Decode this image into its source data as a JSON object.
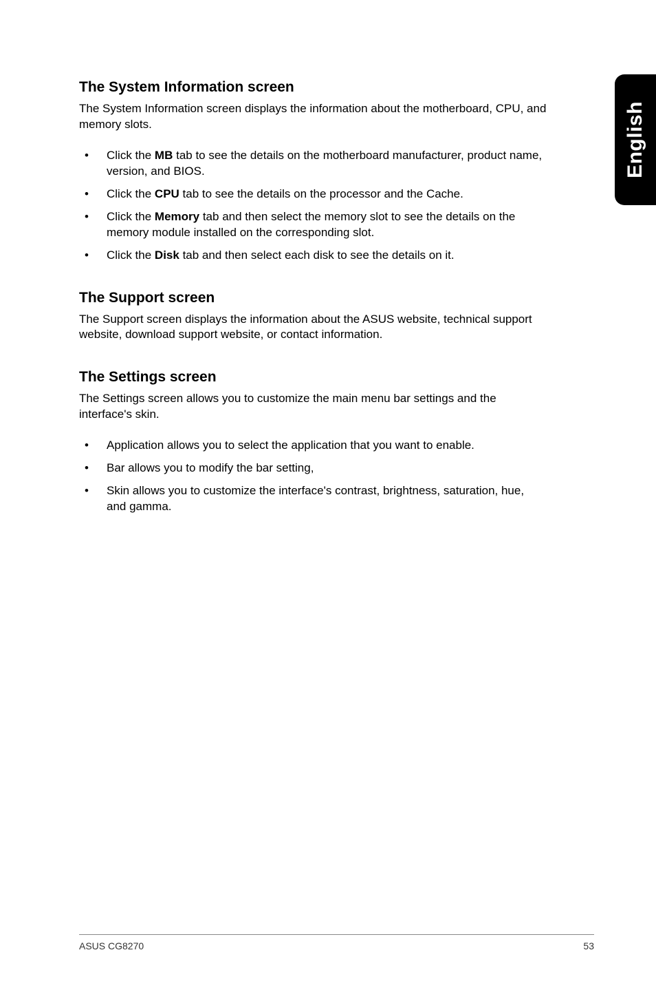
{
  "side_tab": "English",
  "sections": {
    "sysinfo": {
      "title": "The System Information screen",
      "intro": "The System Information screen displays the information about the motherboard, CPU, and memory slots.",
      "bullets": [
        {
          "pre": "Click the ",
          "bold": "MB",
          "post": " tab to see the details on the motherboard manufacturer, product name, version, and BIOS."
        },
        {
          "pre": "Click the ",
          "bold": "CPU",
          "post": " tab to see the details on the processor and the Cache."
        },
        {
          "pre": "Click the ",
          "bold": "Memory",
          "post": " tab and then select the memory slot to see the details on the memory module installed on the corresponding slot."
        },
        {
          "pre": "Click the ",
          "bold": "Disk",
          "post": " tab and then select each disk to see the details on it."
        }
      ]
    },
    "support": {
      "title": "The Support screen",
      "intro": "The Support screen displays the information about the ASUS website, technical support website, download support website, or contact information."
    },
    "settings": {
      "title": "The Settings screen",
      "intro": "The Settings screen allows you to customize the main menu bar settings and the interface's skin.",
      "bullets": [
        {
          "text": "Application allows you to select the application that you want to enable."
        },
        {
          "text": "Bar allows you to modify the bar setting,"
        },
        {
          "text": "Skin allows you to customize the interface's contrast, brightness, saturation, hue, and gamma."
        }
      ]
    }
  },
  "footer": {
    "left": "ASUS CG8270",
    "right": "53"
  }
}
